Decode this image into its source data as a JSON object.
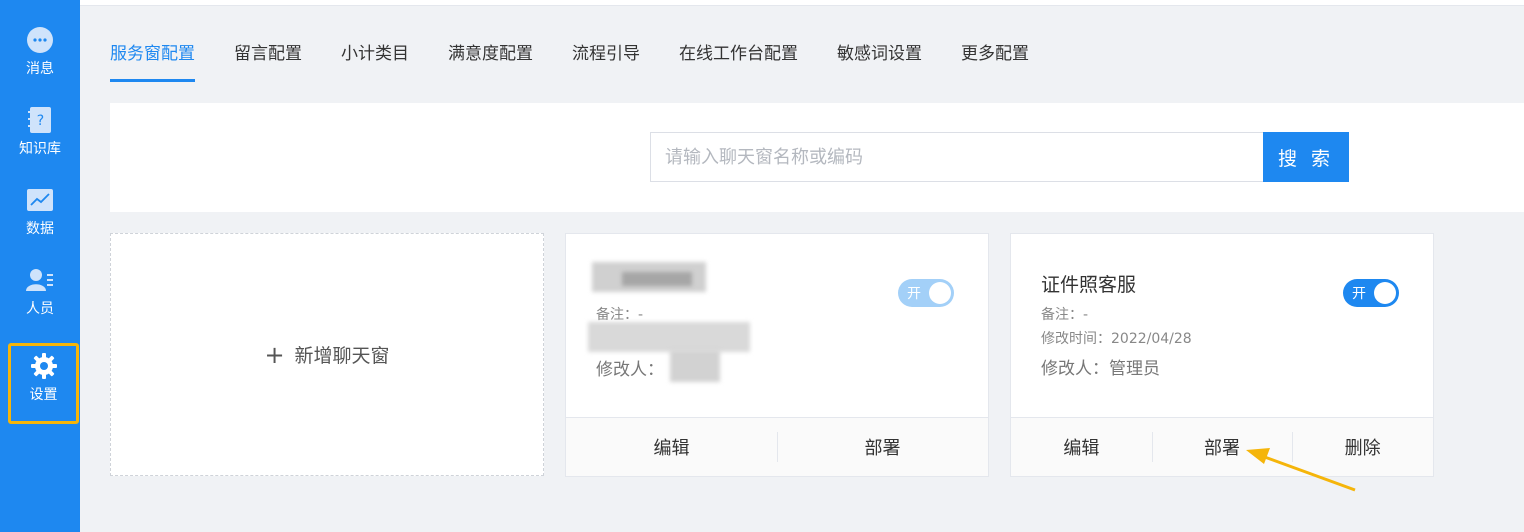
{
  "sidebar": {
    "items": [
      {
        "label": "消息",
        "icon": "chat-bubble-icon"
      },
      {
        "label": "知识库",
        "icon": "knowledge-book-icon"
      },
      {
        "label": "数据",
        "icon": "chart-icon"
      },
      {
        "label": "人员",
        "icon": "person-list-icon"
      },
      {
        "label": "设置",
        "icon": "gear-icon",
        "active": true
      }
    ]
  },
  "tabs": [
    {
      "label": "服务窗配置",
      "active": true
    },
    {
      "label": "留言配置"
    },
    {
      "label": "小计类目"
    },
    {
      "label": "满意度配置"
    },
    {
      "label": "流程引导"
    },
    {
      "label": "在线工作台配置"
    },
    {
      "label": "敏感词设置"
    },
    {
      "label": "更多配置"
    }
  ],
  "search": {
    "placeholder": "请输入聊天窗名称或编码",
    "button_label": "搜 索"
  },
  "add_card": {
    "label": "新增聊天窗",
    "plus": "+"
  },
  "cards": [
    {
      "title": "",
      "remark": "备注：-",
      "modifier": "修改人：",
      "toggle_label": "开",
      "toggle_on": true,
      "buttons": [
        "编辑",
        "部署"
      ]
    },
    {
      "title": "证件照客服",
      "remark": "备注：-",
      "modified_time": "修改时间：2022/04/28",
      "modifier": "修改人：管理员",
      "toggle_label": "开",
      "toggle_on": true,
      "buttons": [
        "编辑",
        "部署",
        "删除"
      ]
    }
  ],
  "colors": {
    "accent": "#1e88f0",
    "highlight": "#f5b50a"
  }
}
